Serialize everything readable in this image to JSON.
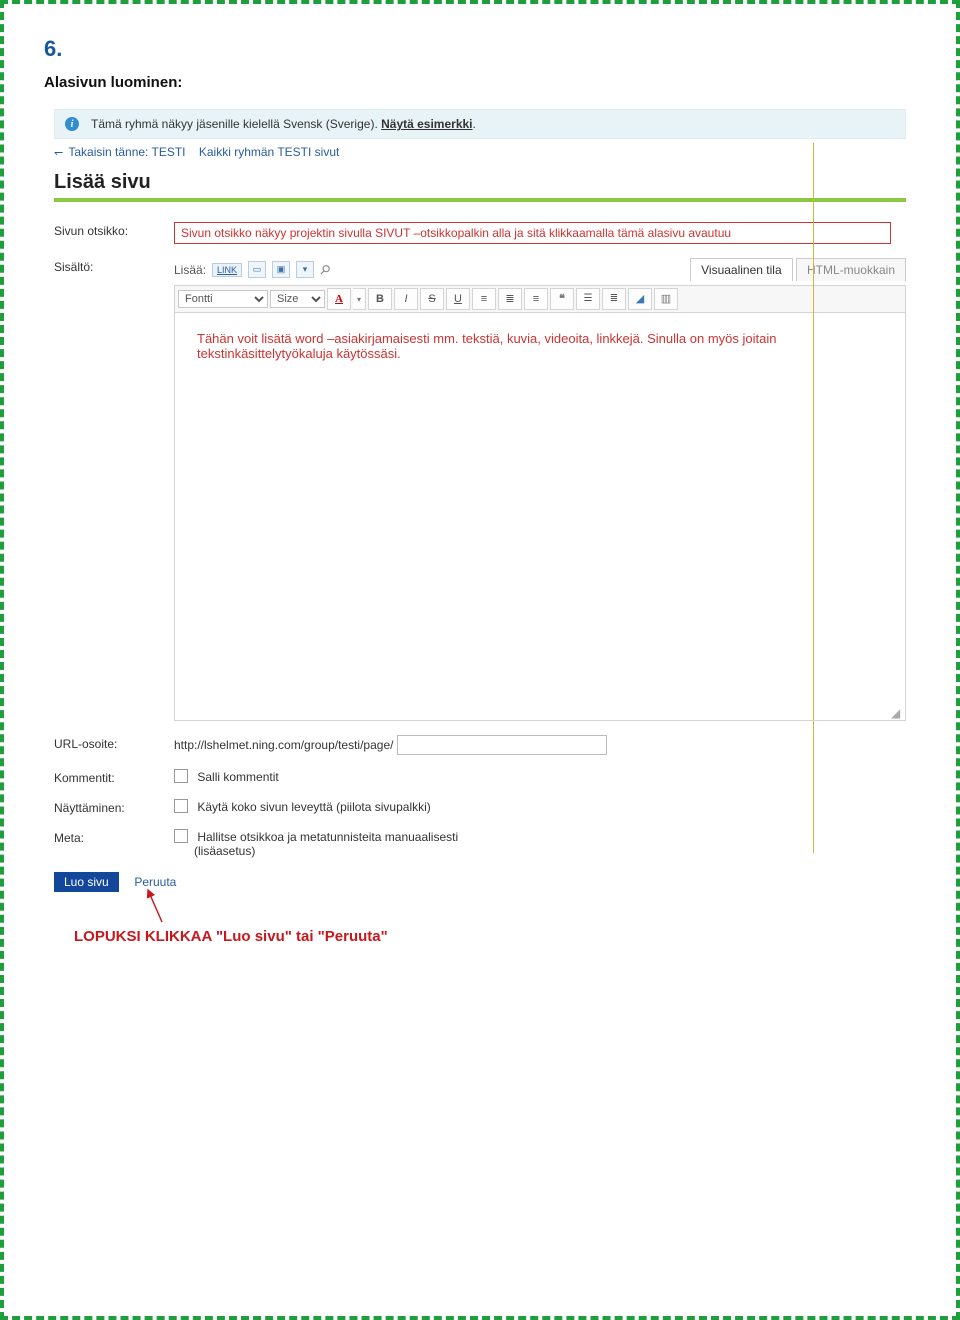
{
  "step_number": "6.",
  "subheading": "Alasivun luominen:",
  "notice": {
    "text_prefix": "Tämä ryhmä näkyy jäsenille kielellä Svensk (Sverige). ",
    "link": "Näytä esimerkki",
    "dot": "."
  },
  "breadcrumbs": {
    "back": "Takaisin tänne: TESTI",
    "all_pages": "Kaikki ryhmän TESTI sivut"
  },
  "page_title": "Lisää sivu",
  "form": {
    "title_label": "Sivun otsikko:",
    "title_note": "Sivun otsikko näkyy projektin sivulla SIVUT –otsikkopalkin alla ja sitä klikkaamalla tämä alasivu avautuu",
    "content_label": "Sisältö:",
    "insert_label": "Lisää:",
    "insert_link_label": "LINK",
    "tabs": {
      "visual": "Visuaalinen tila",
      "html": "HTML-muokkain"
    },
    "toolbar": {
      "font": "Fontti",
      "size": "Size"
    },
    "body_note": "Tähän voit lisätä word –asiakirjamaisesti mm. tekstiä, kuvia, videoita, linkkejä. Sinulla on myös joitain tekstinkäsittelytyökaluja käytössäsi.",
    "url_label": "URL-osoite:",
    "url_prefix": "http://lshelmet.ning.com/group/testi/page/",
    "comments_label": "Kommentit:",
    "comments_cb": "Salli kommentit",
    "display_label": "Näyttäminen:",
    "display_cb": "Käytä koko sivun leveyttä (piilota sivupalkki)",
    "meta_label": "Meta:",
    "meta_cb": "Hallitse otsikkoa ja metatunnisteita manuaalisesti",
    "meta_sub": "(lisäasetus)"
  },
  "actions": {
    "create": "Luo sivu",
    "cancel": "Peruuta"
  },
  "final_note": "LOPUKSI KLIKKAA \"Luo sivu\" tai \"Peruuta\""
}
